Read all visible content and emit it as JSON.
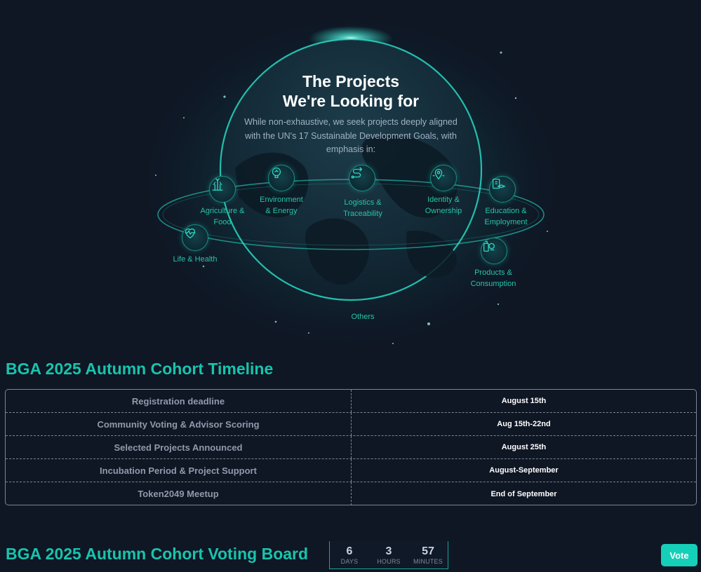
{
  "hero": {
    "title": "The Projects\nWe're Looking for",
    "description": "While non-exhaustive, we seek projects deeply aligned with the UN's 17 Sustainable Development Goals, with emphasis in:",
    "categories": {
      "agriculture": "Agriculture &\nFood",
      "environment": "Environment\n& Energy",
      "logistics": "Logistics &\nTraceability",
      "identity": "Identity &\nOwnership",
      "education": "Education &\nEmployment",
      "life": "Life & Health",
      "products": "Products &\nConsumption",
      "others": "Others"
    }
  },
  "timeline": {
    "title": "BGA 2025 Autumn Cohort Timeline",
    "rows": [
      {
        "event": "Registration deadline",
        "date": "August 15th"
      },
      {
        "event": "Community Voting & Advisor Scoring",
        "date": "Aug 15th-22nd"
      },
      {
        "event": "Selected Projects Announced",
        "date": "August 25th"
      },
      {
        "event": "Incubation Period & Project Support",
        "date": "August-September"
      },
      {
        "event": "Token2049 Meetup",
        "date": "End of September"
      }
    ]
  },
  "voting": {
    "title": "BGA 2025 Autumn Cohort Voting Board",
    "countdown": {
      "days": "6",
      "days_label": "DAYS",
      "hours": "3",
      "hours_label": "HOURS",
      "minutes": "57",
      "minutes_label": "MINUTES"
    },
    "vote_label": "Vote"
  },
  "colors": {
    "background": "#0f1624",
    "accent": "#18c4ad",
    "button": "#16cfb8"
  }
}
